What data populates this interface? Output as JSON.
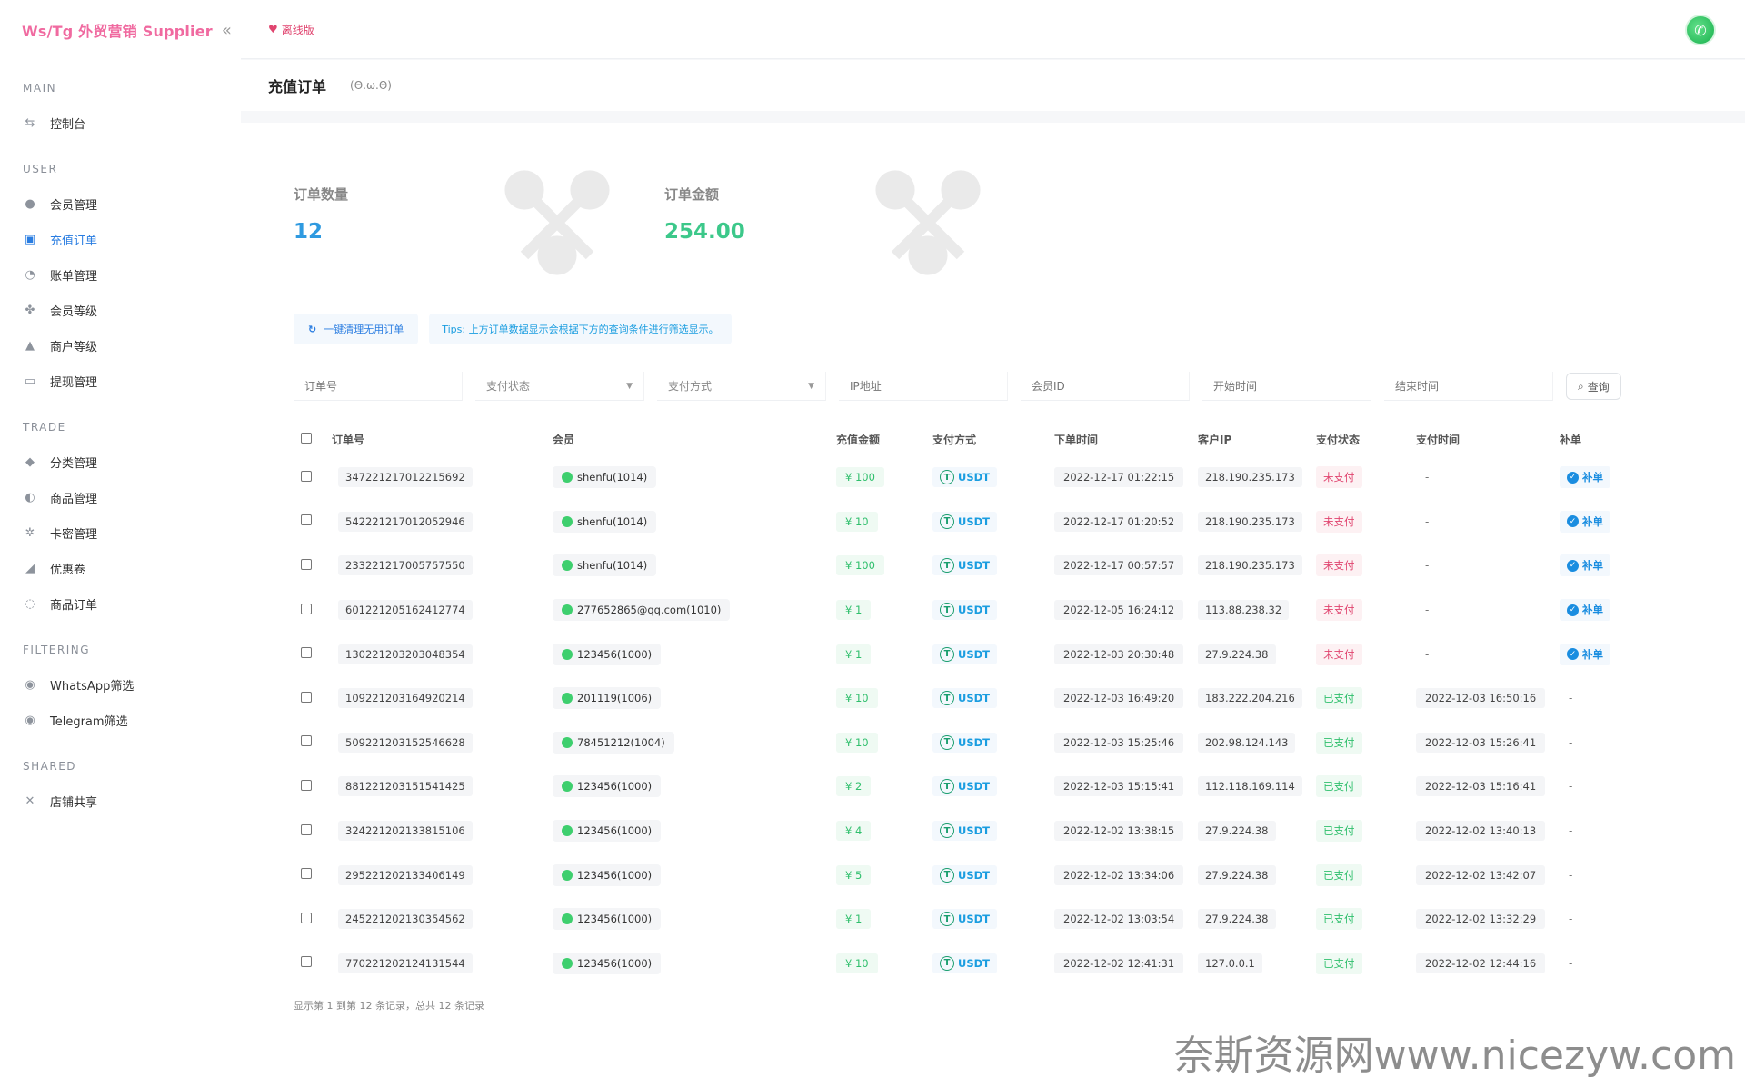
{
  "brand": {
    "title": "Ws/Tg 外贸营销 Supplier"
  },
  "header": {
    "offline": "离线版"
  },
  "page": {
    "title": "充值订单",
    "subtitle": "(Θ.ω.Θ)"
  },
  "sidebar": {
    "sections": [
      {
        "title": "MAIN",
        "items": [
          {
            "label": "控制台",
            "icon": "dashboard-icon"
          }
        ]
      },
      {
        "title": "USER",
        "items": [
          {
            "label": "会员管理",
            "icon": "user-icon"
          },
          {
            "label": "充值订单",
            "icon": "recharge-icon",
            "active": true
          },
          {
            "label": "账单管理",
            "icon": "bill-icon"
          },
          {
            "label": "会员等级",
            "icon": "level-icon"
          },
          {
            "label": "商户等级",
            "icon": "merchant-icon"
          },
          {
            "label": "提现管理",
            "icon": "withdraw-icon"
          }
        ]
      },
      {
        "title": "TRADE",
        "items": [
          {
            "label": "分类管理",
            "icon": "category-icon"
          },
          {
            "label": "商品管理",
            "icon": "product-icon"
          },
          {
            "label": "卡密管理",
            "icon": "card-icon"
          },
          {
            "label": "优惠卷",
            "icon": "coupon-icon"
          },
          {
            "label": "商品订单",
            "icon": "order-icon"
          }
        ]
      },
      {
        "title": "FILTERING",
        "items": [
          {
            "label": "WhatsApp筛选",
            "icon": "whatsapp-icon"
          },
          {
            "label": "Telegram筛选",
            "icon": "telegram-icon"
          }
        ]
      },
      {
        "title": "SHARED",
        "items": [
          {
            "label": "店铺共享",
            "icon": "share-icon"
          }
        ]
      }
    ]
  },
  "stats": {
    "order_count_label": "订单数量",
    "order_count": "12",
    "order_amount_label": "订单金额",
    "order_amount": "254.00"
  },
  "actions": {
    "clean_label": "一键清理无用订单",
    "tips": "Tips: 上方订单数据显示会根据下方的查询条件进行筛选显示。"
  },
  "filters": {
    "order_no": "订单号",
    "pay_status": "支付状态",
    "pay_method": "支付方式",
    "ip": "IP地址",
    "member_id": "会员ID",
    "start_time": "开始时间",
    "end_time": "结束时间",
    "search_label": "查询"
  },
  "table": {
    "headers": {
      "order_no": "订单号",
      "member": "会员",
      "amount": "充值金额",
      "pay_method": "支付方式",
      "order_time": "下单时间",
      "client_ip": "客户IP",
      "status": "支付状态",
      "pay_time": "支付时间",
      "fix": "补单"
    },
    "fix_label": "补单",
    "rows": [
      {
        "no": "347221217012215692",
        "member": "shenfu(1014)",
        "amount": "¥ 100",
        "pay": "USDT",
        "time": "2022-12-17 01:22:15",
        "ip": "218.190.235.173",
        "status": "未支付",
        "paid": false,
        "pay_time": "-"
      },
      {
        "no": "542221217012052946",
        "member": "shenfu(1014)",
        "amount": "¥ 10",
        "pay": "USDT",
        "time": "2022-12-17 01:20:52",
        "ip": "218.190.235.173",
        "status": "未支付",
        "paid": false,
        "pay_time": "-"
      },
      {
        "no": "233221217005757550",
        "member": "shenfu(1014)",
        "amount": "¥ 100",
        "pay": "USDT",
        "time": "2022-12-17 00:57:57",
        "ip": "218.190.235.173",
        "status": "未支付",
        "paid": false,
        "pay_time": "-"
      },
      {
        "no": "601221205162412774",
        "member": "277652865@qq.com(1010)",
        "amount": "¥ 1",
        "pay": "USDT",
        "time": "2022-12-05 16:24:12",
        "ip": "113.88.238.32",
        "status": "未支付",
        "paid": false,
        "pay_time": "-"
      },
      {
        "no": "130221203203048354",
        "member": "123456(1000)",
        "amount": "¥ 1",
        "pay": "USDT",
        "time": "2022-12-03 20:30:48",
        "ip": "27.9.224.38",
        "status": "未支付",
        "paid": false,
        "pay_time": "-"
      },
      {
        "no": "109221203164920214",
        "member": "201119(1006)",
        "amount": "¥ 10",
        "pay": "USDT",
        "time": "2022-12-03 16:49:20",
        "ip": "183.222.204.216",
        "status": "已支付",
        "paid": true,
        "pay_time": "2022-12-03 16:50:16"
      },
      {
        "no": "509221203152546628",
        "member": "78451212(1004)",
        "amount": "¥ 10",
        "pay": "USDT",
        "time": "2022-12-03 15:25:46",
        "ip": "202.98.124.143",
        "status": "已支付",
        "paid": true,
        "pay_time": "2022-12-03 15:26:41"
      },
      {
        "no": "881221203151541425",
        "member": "123456(1000)",
        "amount": "¥ 2",
        "pay": "USDT",
        "time": "2022-12-03 15:15:41",
        "ip": "112.118.169.114",
        "status": "已支付",
        "paid": true,
        "pay_time": "2022-12-03 15:16:41"
      },
      {
        "no": "324221202133815106",
        "member": "123456(1000)",
        "amount": "¥ 4",
        "pay": "USDT",
        "time": "2022-12-02 13:38:15",
        "ip": "27.9.224.38",
        "status": "已支付",
        "paid": true,
        "pay_time": "2022-12-02 13:40:13"
      },
      {
        "no": "295221202133406149",
        "member": "123456(1000)",
        "amount": "¥ 5",
        "pay": "USDT",
        "time": "2022-12-02 13:34:06",
        "ip": "27.9.224.38",
        "status": "已支付",
        "paid": true,
        "pay_time": "2022-12-02 13:42:07"
      },
      {
        "no": "245221202130354562",
        "member": "123456(1000)",
        "amount": "¥ 1",
        "pay": "USDT",
        "time": "2022-12-02 13:03:54",
        "ip": "27.9.224.38",
        "status": "已支付",
        "paid": true,
        "pay_time": "2022-12-02 13:32:29"
      },
      {
        "no": "770221202124131544",
        "member": "123456(1000)",
        "amount": "¥ 10",
        "pay": "USDT",
        "time": "2022-12-02 12:41:31",
        "ip": "127.0.0.1",
        "status": "已支付",
        "paid": true,
        "pay_time": "2022-12-02 12:44:16"
      }
    ]
  },
  "footer": {
    "summary": "显示第 1 到第 12 条记录，总共 12 条记录"
  },
  "watermark": "奈斯资源网www.nicezyw.com",
  "colors": {
    "accent": "#2a7de1",
    "brand": "#f06aa0",
    "paid": "#2fbf6c",
    "unpaid": "#e0446f"
  }
}
